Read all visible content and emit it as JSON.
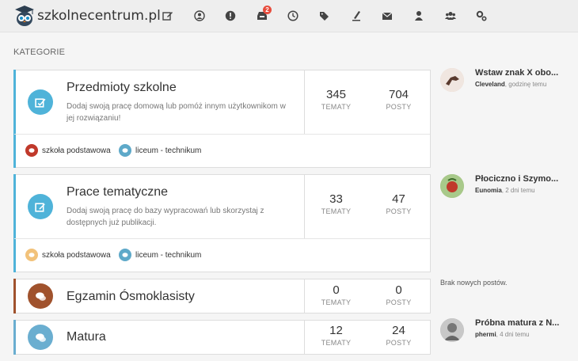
{
  "brand": {
    "name": "szkolnecentrum.pl"
  },
  "nav": {
    "icons": [
      "edit-icon",
      "user-circle-icon",
      "alert-icon",
      "inbox-icon",
      "clock-icon",
      "tags-icon",
      "pen-icon",
      "envelope-icon",
      "user-icon",
      "users-icon",
      "cogs-icon"
    ],
    "notification_count": "2"
  },
  "section": {
    "title": "KATEGORIE"
  },
  "categories": [
    {
      "title": "Przedmioty szkolne",
      "desc": "Dodaj swoją pracę domową lub pomóż innym użytkownikom w jej rozwiązaniu!",
      "topics": "345",
      "posts": "704",
      "color": "#4fb3d9",
      "icon": "edit-icon",
      "tags": [
        {
          "label": "szkoła podstawowa",
          "color": "#c0392b"
        },
        {
          "label": "liceum - technikum",
          "color": "#5ea9c9"
        }
      ]
    },
    {
      "title": "Prace tematyczne",
      "desc": "Dodaj swoją pracę do bazy wypracowań lub skorzystaj z dostępnych już publikacji.",
      "topics": "33",
      "posts": "47",
      "color": "#4fb3d9",
      "icon": "edit-icon",
      "tags": [
        {
          "label": "szkoła podstawowa",
          "color": "#f2c27a"
        },
        {
          "label": "liceum - technikum",
          "color": "#5ea9c9"
        }
      ]
    },
    {
      "title": "Egzamin Ósmoklasisty",
      "topics": "0",
      "posts": "0",
      "color": "#a0522d",
      "icon": "comments-icon"
    },
    {
      "title": "Matura",
      "topics": "12",
      "posts": "24",
      "color": "#6aaed0",
      "icon": "comments-icon"
    }
  ],
  "labels": {
    "topics": "TEMATY",
    "posts": "POSTY"
  },
  "recent": [
    {
      "title": "Wstaw znak X obo...",
      "user": "Cleveland",
      "time": "godzinę temu"
    },
    {
      "title": "Płociczno i Szymo...",
      "user": "Eunomia",
      "time": "2 dni temu"
    },
    {
      "title": "Próbna matura z N...",
      "user": "phermi",
      "time": "4 dni temu"
    }
  ],
  "no_new": "Brak nowych postów."
}
